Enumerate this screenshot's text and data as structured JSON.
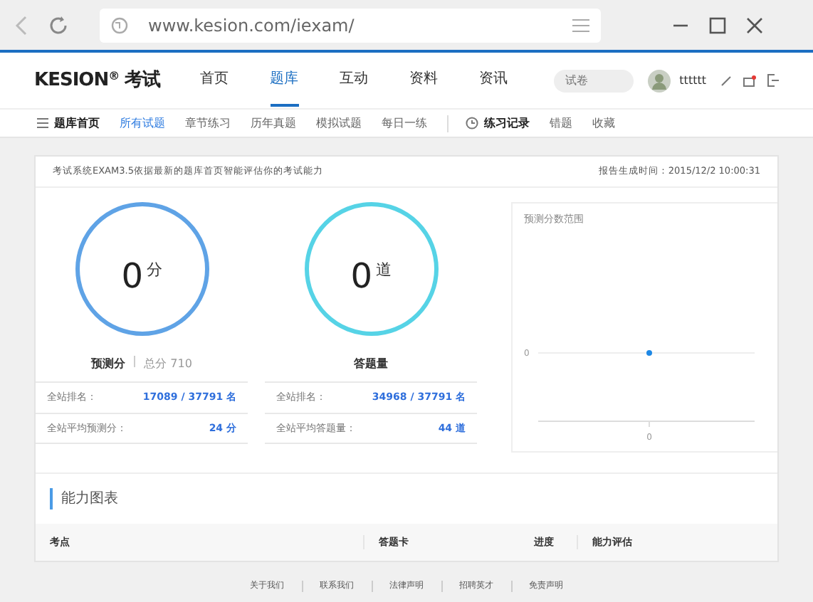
{
  "browser": {
    "url": "www.kesion.com/iexam/"
  },
  "site": {
    "logo": "KESION",
    "logo_mark": "®",
    "logo_suffix": "考试",
    "nav": [
      {
        "label": "首页",
        "selected": false
      },
      {
        "label": "题库",
        "selected": true
      },
      {
        "label": "互动",
        "selected": false
      },
      {
        "label": "资料",
        "selected": false
      },
      {
        "label": "资讯",
        "selected": false
      }
    ],
    "search": {
      "placeholder": "试卷"
    },
    "username": "tttttt"
  },
  "subnav": [
    {
      "label": "题库首页",
      "kind": "menu",
      "selected": false
    },
    {
      "label": "所有试题",
      "kind": "link",
      "selected": true
    },
    {
      "label": "章节练习",
      "kind": "link",
      "selected": false
    },
    {
      "label": "历年真题",
      "kind": "link",
      "selected": false
    },
    {
      "label": "模拟试题",
      "kind": "link",
      "selected": false
    },
    {
      "label": "每日一练",
      "kind": "link",
      "selected": false
    },
    {
      "label": "练习记录",
      "kind": "history",
      "selected": false
    },
    {
      "label": "错题",
      "kind": "link",
      "selected": false
    },
    {
      "label": "收藏",
      "kind": "link",
      "selected": false
    }
  ],
  "report": {
    "intro": "考试系统EXAM3.5依据最新的题库首页智能评估你的考试能力",
    "generated": "报告生成时间：2015/12/2 10:00:31"
  },
  "stats": [
    {
      "value": "0",
      "unit": "分",
      "title": "预测分",
      "subtitle": "总分 710",
      "color": "#5fa3e6",
      "rows": [
        {
          "label": "全站排名：",
          "value": "17089 / 37791 名"
        },
        {
          "label": "全站平均预测分：",
          "value": "24 分"
        }
      ]
    },
    {
      "value": "0",
      "unit": "道",
      "title": "答题量",
      "color": "#56d3e6",
      "rows": [
        {
          "label": "全站排名：",
          "value": "34968 / 37791 名"
        },
        {
          "label": "全站平均答题量：",
          "value": "44 道"
        }
      ]
    }
  ],
  "chart": {
    "title": "预测分数范围",
    "y_label": "0",
    "x_label": "0"
  },
  "section": {
    "title": "能力图表",
    "columns": [
      "考点",
      "答题卡",
      "进度",
      "能力评估"
    ]
  },
  "footer": [
    "关于我们",
    "联系我们",
    "法律声明",
    "招聘英才",
    "免责声明"
  ]
}
